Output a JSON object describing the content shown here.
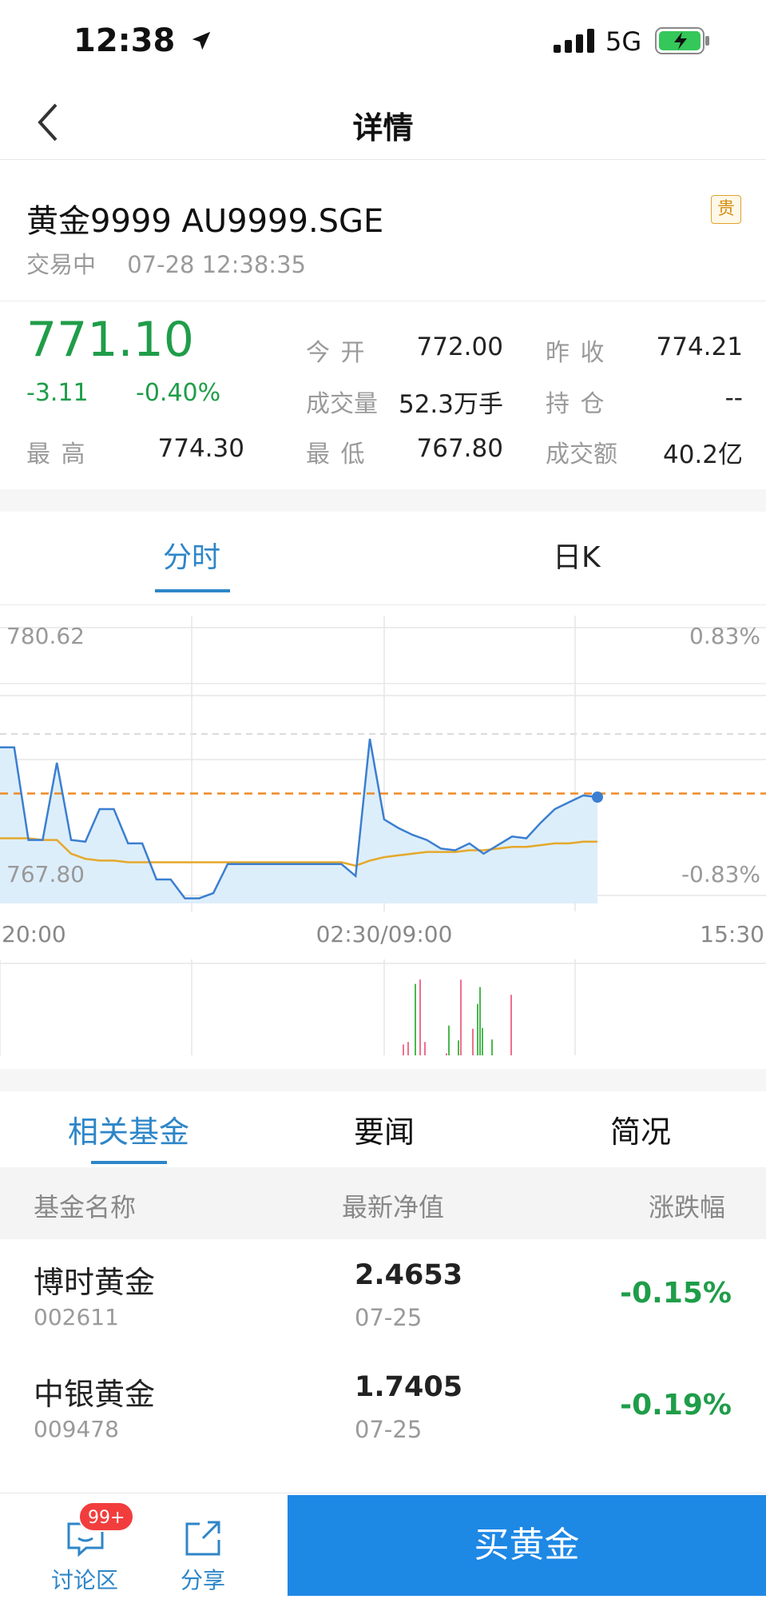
{
  "status_bar": {
    "time": "12:38",
    "network": "5G"
  },
  "nav": {
    "title": "详情"
  },
  "instrument": {
    "name": "黄金9999 AU9999.SGE",
    "badge": "贵",
    "state": "交易中",
    "timestamp": "07-28 12:38:35",
    "price": "771.10",
    "change": "-3.11",
    "change_pct": "-0.40%",
    "colors": {
      "down": "#1f9d49",
      "accent": "#2e86c8"
    }
  },
  "quote": {
    "open_label": "今 开",
    "open": "772.00",
    "prev_label": "昨 收",
    "prev": "774.21",
    "volume_label": "成交量",
    "volume": "52.3万手",
    "position_label": "持 仓",
    "position": "--",
    "high_label": "最 高",
    "high": "774.30",
    "low_label": "最 低",
    "low": "767.80",
    "amount_label": "成交额",
    "amount": "40.2亿"
  },
  "chart_tabs": [
    {
      "label": "分时",
      "active": true
    },
    {
      "label": "日K",
      "active": false
    }
  ],
  "chart_data": {
    "type": "line",
    "y_top_label": "780.62",
    "y_bottom_label": "767.80",
    "pct_top_label": "0.83%",
    "pct_bottom_label": "-0.83%",
    "x_labels": [
      "20:00",
      "02:30/09:00",
      "15:30"
    ],
    "ylim": [
      767.8,
      780.62
    ],
    "reference_price": 774.21,
    "grid": true,
    "series": [
      {
        "values": [
          776.9,
          776.9,
          771.5,
          771.5,
          776.0,
          771.5,
          771.4,
          773.3,
          773.3,
          771.3,
          771.3,
          769.2,
          769.2,
          768.1,
          768.1,
          768.4,
          770.1,
          770.1,
          770.1,
          770.1,
          770.1,
          770.1,
          770.1,
          770.1,
          770.1,
          769.4,
          777.4,
          772.7,
          772.2,
          771.8,
          771.5,
          771.0,
          770.9,
          771.3,
          770.7,
          771.2,
          771.7,
          771.6,
          772.5,
          773.3,
          773.7,
          774.1,
          774.0
        ]
      },
      {
        "values": [
          771.6,
          771.6,
          771.6,
          771.5,
          771.5,
          770.7,
          770.4,
          770.3,
          770.3,
          770.2,
          770.2,
          770.2,
          770.2,
          770.2,
          770.2,
          770.2,
          770.2,
          770.2,
          770.2,
          770.2,
          770.2,
          770.2,
          770.2,
          770.2,
          770.2,
          770.0,
          770.3,
          770.5,
          770.6,
          770.7,
          770.8,
          770.8,
          770.8,
          770.9,
          770.9,
          771.0,
          771.1,
          771.1,
          771.2,
          771.3,
          771.3,
          771.4,
          771.4
        ]
      }
    ]
  },
  "lower_tabs": [
    {
      "label": "相关基金",
      "active": true
    },
    {
      "label": "要闻",
      "active": false
    },
    {
      "label": "简况",
      "active": false
    }
  ],
  "fund_table": {
    "headers": [
      "基金名称",
      "最新净值",
      "涨跌幅"
    ],
    "rows": [
      {
        "name": "博时黄金",
        "code": "002611",
        "nav": "2.4653",
        "date": "07-25",
        "pct": "-0.15%"
      },
      {
        "name": "中银黄金",
        "code": "009478",
        "nav": "1.7405",
        "date": "07-25",
        "pct": "-0.19%"
      }
    ]
  },
  "bottom_bar": {
    "discuss_label": "讨论区",
    "discuss_badge": "99+",
    "share_label": "分享",
    "buy_label": "买黄金"
  }
}
